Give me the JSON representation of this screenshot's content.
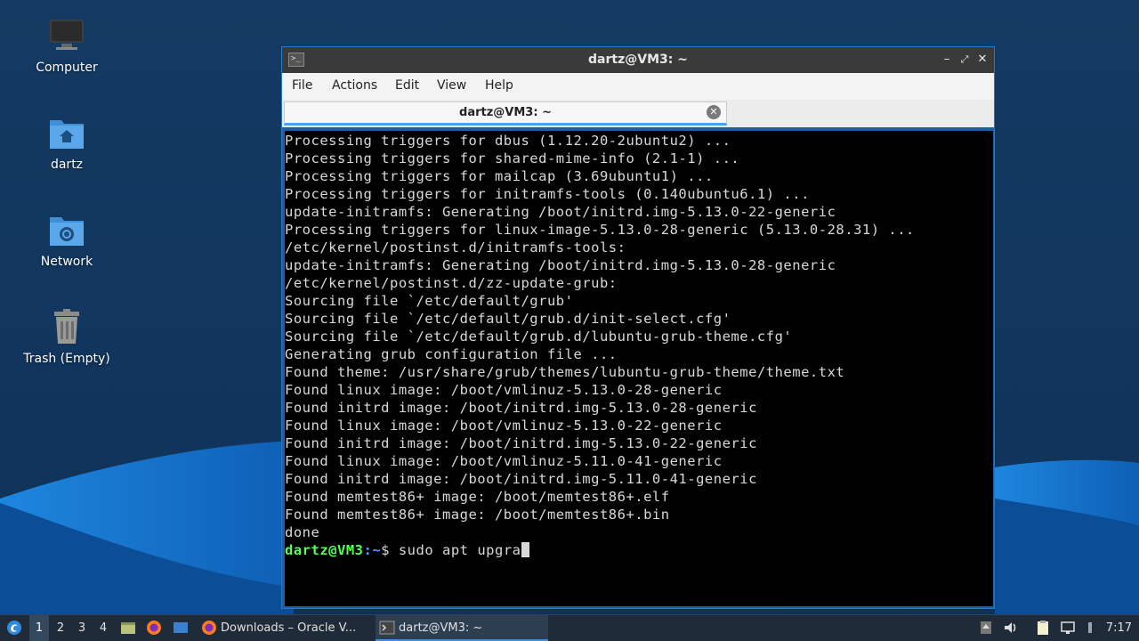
{
  "desktop": {
    "icons": [
      {
        "label": "Computer",
        "icon": "computer-icon"
      },
      {
        "label": "dartz",
        "icon": "home-folder-icon"
      },
      {
        "label": "Network",
        "icon": "network-folder-icon"
      },
      {
        "label": "Trash (Empty)",
        "icon": "trash-icon"
      }
    ]
  },
  "window": {
    "title": "dartz@VM3: ~",
    "menu": [
      "File",
      "Actions",
      "Edit",
      "View",
      "Help"
    ],
    "tab_label": "dartz@VM3: ~"
  },
  "terminal": {
    "lines": [
      "Processing triggers for dbus (1.12.20-2ubuntu2) ...",
      "Processing triggers for shared-mime-info (2.1-1) ...",
      "Processing triggers for mailcap (3.69ubuntu1) ...",
      "Processing triggers for initramfs-tools (0.140ubuntu6.1) ...",
      "update-initramfs: Generating /boot/initrd.img-5.13.0-22-generic",
      "Processing triggers for linux-image-5.13.0-28-generic (5.13.0-28.31) ...",
      "/etc/kernel/postinst.d/initramfs-tools:",
      "update-initramfs: Generating /boot/initrd.img-5.13.0-28-generic",
      "/etc/kernel/postinst.d/zz-update-grub:",
      "Sourcing file `/etc/default/grub'",
      "Sourcing file `/etc/default/grub.d/init-select.cfg'",
      "Sourcing file `/etc/default/grub.d/lubuntu-grub-theme.cfg'",
      "Generating grub configuration file ...",
      "Found theme: /usr/share/grub/themes/lubuntu-grub-theme/theme.txt",
      "Found linux image: /boot/vmlinuz-5.13.0-28-generic",
      "Found initrd image: /boot/initrd.img-5.13.0-28-generic",
      "Found linux image: /boot/vmlinuz-5.13.0-22-generic",
      "Found initrd image: /boot/initrd.img-5.13.0-22-generic",
      "Found linux image: /boot/vmlinuz-5.11.0-41-generic",
      "Found initrd image: /boot/initrd.img-5.11.0-41-generic",
      "Found memtest86+ image: /boot/memtest86+.elf",
      "Found memtest86+ image: /boot/memtest86+.bin",
      "done"
    ],
    "prompt_user": "dartz@VM3",
    "prompt_path": ":~",
    "prompt_symbol": "$ ",
    "command": "sudo apt upgra"
  },
  "taskbar": {
    "desktops": [
      "1",
      "2",
      "3",
      "4"
    ],
    "active_desktop": "1",
    "tasks": [
      {
        "label": "Downloads – Oracle V...",
        "icon": "firefox-icon"
      },
      {
        "label": "dartz@VM3: ~",
        "icon": "terminal-icon"
      }
    ],
    "clock": "7:17"
  },
  "colors": {
    "wallpaper_dark": "#14375e",
    "wallpaper_wave": "#1a7fd6",
    "terminal_bg": "#000000",
    "prompt_user": "#55ff55",
    "prompt_path": "#5599ff",
    "accent": "#3b8ee0"
  }
}
